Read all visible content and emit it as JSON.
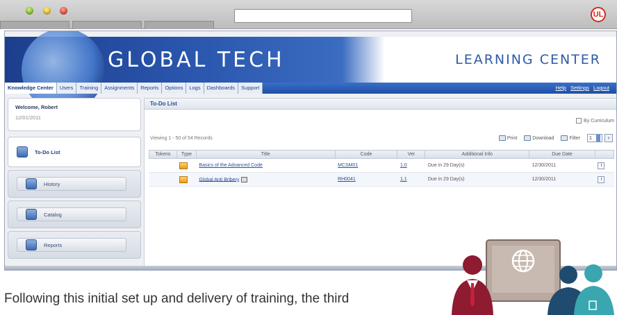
{
  "browser": {
    "ul_logo": "UL"
  },
  "banner": {
    "brand": "GLOBAL TECH",
    "subtitle": "LEARNING CENTER"
  },
  "nav": {
    "tabs": [
      "Knowledge Center",
      "Users",
      "Training",
      "Assignments",
      "Reports",
      "Options",
      "Logs",
      "Dashboards",
      "Support"
    ],
    "links": [
      "Help",
      "Settings",
      "Logout"
    ]
  },
  "sidebar": {
    "welcome_name": "Welcome, Robert",
    "welcome_date": "12/01/2011",
    "active_item": "To-Do List",
    "items": [
      "History",
      "Catalog",
      "Reports"
    ]
  },
  "content": {
    "title": "To-Do List",
    "by_curriculum": "By Curriculum",
    "viewing": "Viewing 1 - 50 of 54 Records",
    "print": "Print",
    "download": "Download",
    "filter": "Filter",
    "page": "1",
    "columns": [
      "Tokens",
      "Type",
      "Title",
      "Code",
      "Ver",
      "Additional Info",
      "Due Date",
      ""
    ],
    "rows": [
      {
        "title": "Basics of the Advanced Code",
        "code": "MCSM01",
        "ver": "1.0",
        "info": "Due in 29 Day(s)",
        "due": "12/30/2011"
      },
      {
        "title": "Global Anti Bribery",
        "code": "RH0041",
        "ver": "1.1",
        "info": "Due in 29 Day(s)",
        "due": "12/30/2011"
      }
    ]
  },
  "caption": "Following this initial set up and delivery of training, the third"
}
